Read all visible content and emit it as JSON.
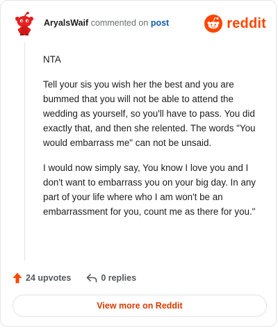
{
  "comment": {
    "username": "AryalsWaif",
    "action_text": "commented on",
    "post_link": "post"
  },
  "brand": {
    "name": "reddit",
    "color": "#ff4500"
  },
  "body": {
    "paragraphs": [
      "NTA",
      "Tell your sis you wish her the best and you are bummed that you will not be able to attend the wedding as yourself, so you'll have to pass. You did exactly that, and then she relented. The words \"You would embarrass me\" can not be unsaid.",
      "I would now simply say, You know I love you and I don't want to embarrass you on your big day. In any part of your life where who I am won't be an embarrassment for you, count me as there for you.\""
    ]
  },
  "actions": {
    "upvotes_label": "24 upvotes",
    "replies_label": "0 replies"
  },
  "footer": {
    "view_more_label": "View more on Reddit"
  },
  "colors": {
    "upvote": "#ff4500",
    "link": "#0f5da8",
    "view_more_text": "#d93a00"
  }
}
